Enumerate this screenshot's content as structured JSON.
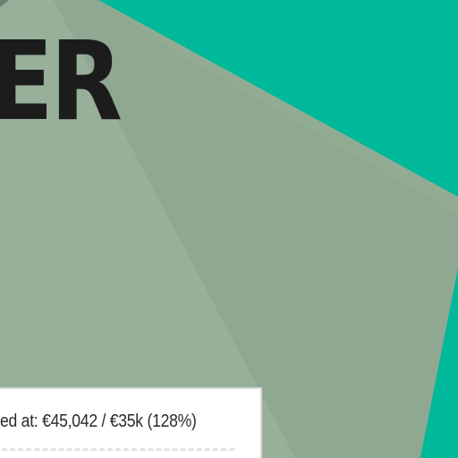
{
  "colors": {
    "background": "#00b89a",
    "poly_primary": "#8ea891",
    "poly_secondary": "#98af99",
    "poly_tertiary": "#92ac94",
    "headline": "#1c1c1c",
    "panel": "#ffffff"
  },
  "banner": {
    "headline": "ER"
  },
  "funding": {
    "label": "ed at:",
    "raised": "€45,042",
    "separator": "/",
    "goal": "€35k",
    "percent_text": "(128%)",
    "percent": 128
  }
}
